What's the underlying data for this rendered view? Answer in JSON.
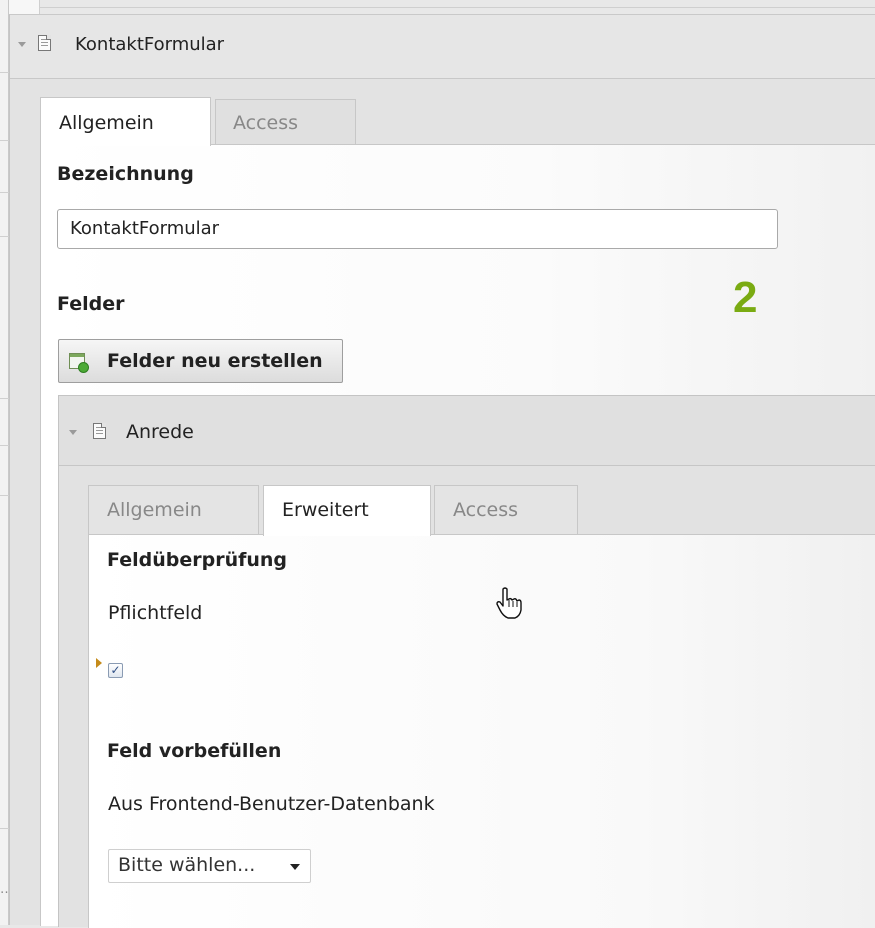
{
  "panel": {
    "title": "KontaktFormular",
    "tabs": [
      {
        "label": "Allgemein",
        "active": true
      },
      {
        "label": "Access",
        "active": false
      }
    ],
    "bezeichnung_label": "Bezeichnung",
    "bezeichnung_value": "KontaktFormular",
    "felder_label": "Felder",
    "new_fields_button": "Felder neu erstellen",
    "step_marker": "2"
  },
  "field": {
    "title": "Anrede",
    "tabs": [
      {
        "label": "Allgemein",
        "active": false
      },
      {
        "label": "Erweitert",
        "active": true
      },
      {
        "label": "Access",
        "active": false
      }
    ],
    "validation_heading": "Feldüberprüfung",
    "required_label": "Pflichtfeld",
    "required_checked": true,
    "checkmark": "✓",
    "prefill_heading": "Feld vorbefüllen",
    "prefill_source_label": "Aus Frontend-Benutzer-Datenbank",
    "select_value": "Bitte wählen..."
  },
  "icons": {
    "collapse": "chevron-down-icon",
    "record": "document-icon",
    "new_record": "new-record-icon",
    "indicator": "arrow-right-icon",
    "cursor": "hand-pointer-icon"
  },
  "colors": {
    "marker": "#7aab12",
    "indicator": "#c58b1a"
  }
}
